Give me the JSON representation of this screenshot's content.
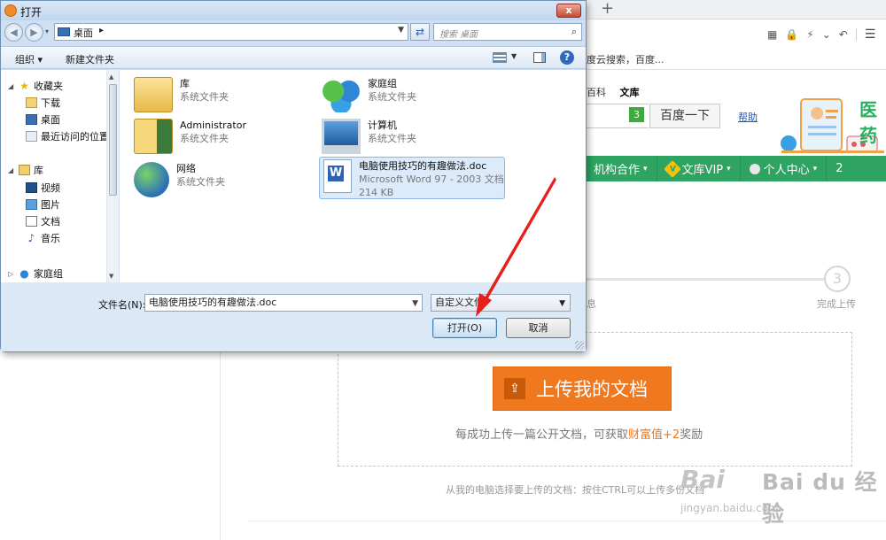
{
  "dialog": {
    "title": "打开",
    "address": {
      "location": "桌面",
      "breadcrumb_arrow": "▸"
    },
    "search_placeholder": "搜索 桌面",
    "command_bar": {
      "organize": "组织 ▾",
      "new_folder": "新建文件夹"
    },
    "nav_pane": {
      "favorites_label": "收藏夹",
      "favorites": [
        "下载",
        "桌面",
        "最近访问的位置"
      ],
      "library_label": "库",
      "libraries": [
        "视频",
        "图片",
        "文档",
        "音乐"
      ],
      "homegroup_label": "家庭组"
    },
    "items": [
      {
        "name": "库",
        "sub": "系统文件夹",
        "icon": "library-icon"
      },
      {
        "name": "家庭组",
        "sub": "系统文件夹",
        "icon": "homegroup-icon"
      },
      {
        "name": "Administrator",
        "sub": "系统文件夹",
        "icon": "user-folder-icon"
      },
      {
        "name": "计算机",
        "sub": "系统文件夹",
        "icon": "computer-icon"
      },
      {
        "name": "网络",
        "sub": "系统文件夹",
        "icon": "network-icon"
      },
      {
        "name": "电脑使用技巧的有趣做法.doc",
        "sub": "Microsoft Word 97 - 2003 文档",
        "size": "214 KB",
        "icon": "word-doc-icon",
        "selected": true
      }
    ],
    "filename_label": "文件名(N):",
    "filename_value": "电脑使用技巧的有趣做法.doc",
    "filetype_value": "自定义文件",
    "open_button": "打开(O)",
    "cancel_button": "取消",
    "close_button": "x"
  },
  "browser": {
    "new_tab": "+",
    "suggest_text": "度云搜索，百度...",
    "site_tabs": [
      "百科",
      "文库"
    ],
    "search_badge": "3",
    "search_button": "百度一下",
    "help_link": "帮助",
    "banner_text": "医药",
    "nav": [
      {
        "label": "机构合作",
        "caret": "▾"
      },
      {
        "label": "文库VIP",
        "caret": "▾"
      },
      {
        "label": "个人中心",
        "caret": "▾"
      },
      {
        "label": "2",
        "caret": ""
      }
    ],
    "steps": {
      "step2_tail": "息",
      "step3_number": "3",
      "step3_label": "完成上传"
    },
    "upload": {
      "button": "上传我的文档",
      "tip_before": "每成功上传一篇公开文档，可获取",
      "tip_highlight": "财富值+2",
      "tip_after": "奖励",
      "bottom_hint": "从我的电脑选择要上传的文档：按住CTRL可以上传多份文档"
    },
    "watermark": {
      "brand": "Bai du 经验",
      "url": "jingyan.baidu.com"
    }
  },
  "colors": {
    "dialog_bg": "#cfe0f2",
    "accent_orange": "#f0781e",
    "nav_green": "#2fa361",
    "arrow_red": "#e8201c"
  }
}
